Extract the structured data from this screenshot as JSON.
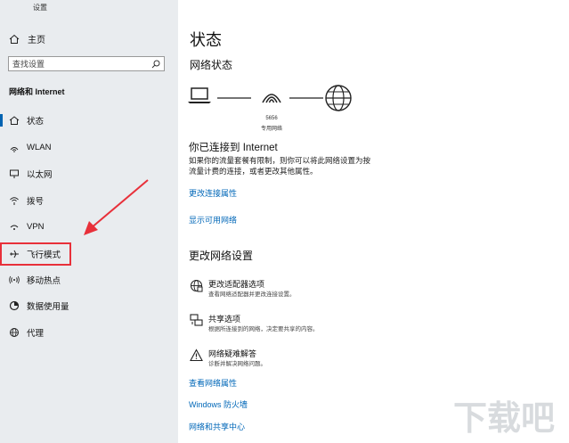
{
  "window": {
    "title": "设置"
  },
  "sidebar": {
    "home_label": "主页",
    "search_placeholder": "查找设置",
    "section_title": "网络和 Internet",
    "items": [
      {
        "label": "状态",
        "icon": "home-status-icon",
        "selected": true
      },
      {
        "label": "WLAN",
        "icon": "wifi-icon"
      },
      {
        "label": "以太网",
        "icon": "ethernet-icon"
      },
      {
        "label": "拨号",
        "icon": "dialup-icon"
      },
      {
        "label": "VPN",
        "icon": "vpn-icon"
      },
      {
        "label": "飞行模式",
        "icon": "airplane-icon",
        "highlighted": true
      },
      {
        "label": "移动热点",
        "icon": "hotspot-icon"
      },
      {
        "label": "数据使用量",
        "icon": "data-usage-icon"
      },
      {
        "label": "代理",
        "icon": "globe-icon"
      }
    ]
  },
  "main": {
    "title": "状态",
    "network_status_heading": "网络状态",
    "network": {
      "ssid": "5656",
      "type": "专用网络"
    },
    "connected_title": "你已连接到 Internet",
    "connected_desc": "如果你的流量套餐有限制，则你可以将此网络设置为按流量计费的连接，或者更改其他属性。",
    "links_top": {
      "change_properties": "更改连接属性",
      "show_networks": "显示可用网络"
    },
    "settings_heading": "更改网络设置",
    "options": [
      {
        "title": "更改适配器选项",
        "desc": "查看网络适配器并更改连接设置。",
        "icon": "adapter-icon"
      },
      {
        "title": "共享选项",
        "desc": "根据所连接到的网络，决定要共享的内容。",
        "icon": "sharing-icon"
      },
      {
        "title": "网络疑难解答",
        "desc": "诊断并解决网络问题。",
        "icon": "warning-icon"
      }
    ],
    "links_bottom": {
      "view_properties": "查看网络属性",
      "firewall": "Windows 防火墙",
      "sharing_center": "网络和共享中心"
    }
  },
  "colors": {
    "accent": "#0063b1",
    "link": "#0067b8",
    "highlight": "#e8303a",
    "sidebar_bg": "#e9ecef"
  },
  "watermark": {
    "text": "下载吧"
  }
}
